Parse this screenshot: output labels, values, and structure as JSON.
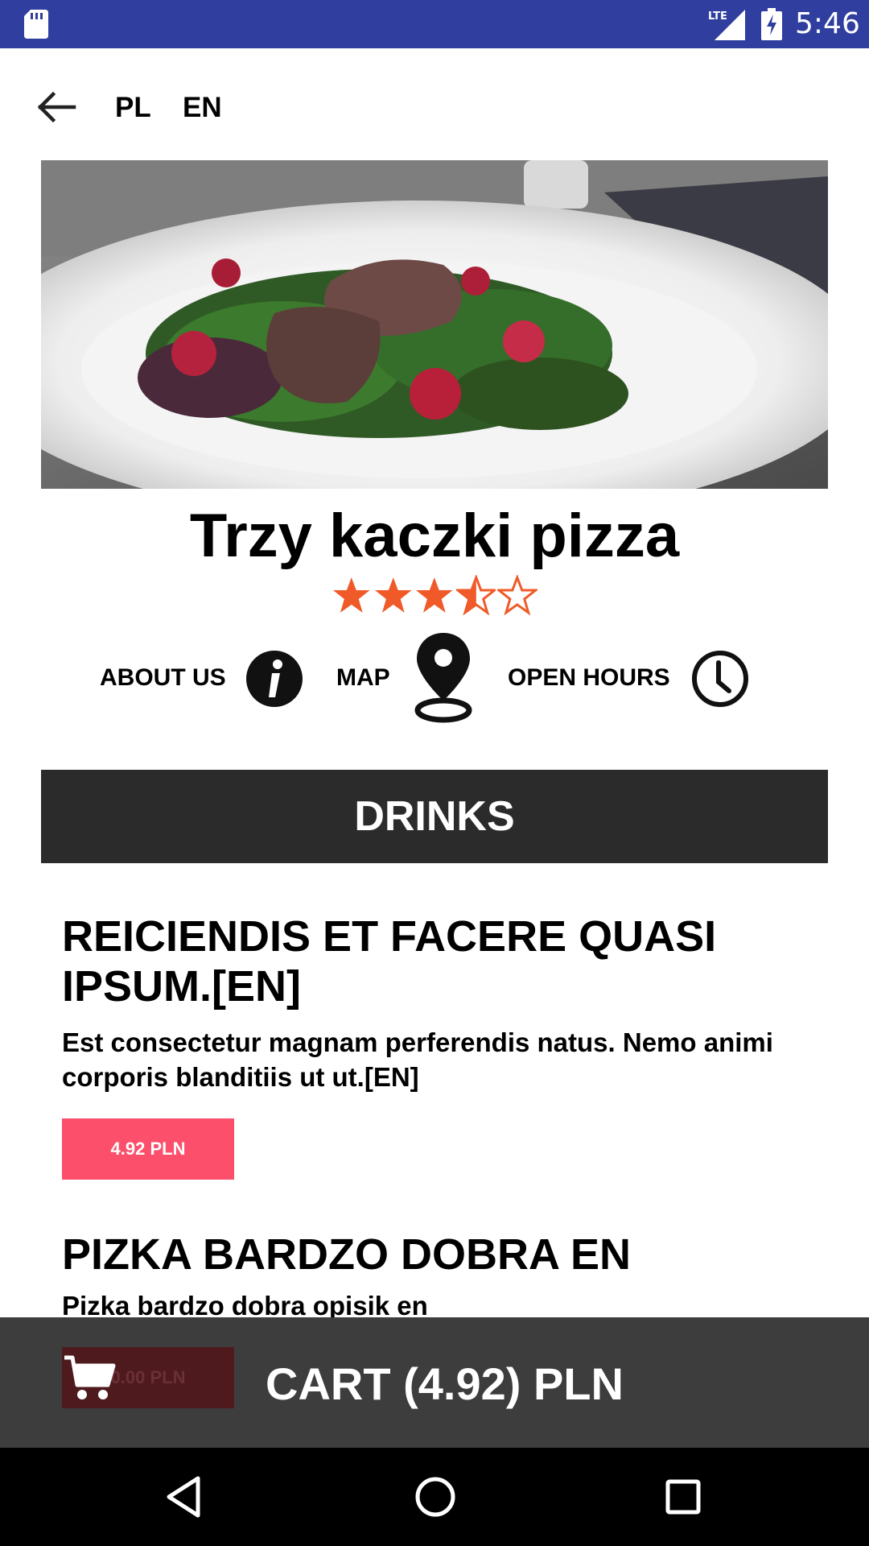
{
  "status_bar": {
    "time": "5:46",
    "network": "LTE",
    "color": "#303f9f",
    "icons": [
      "sd-card-icon",
      "lte-signal-icon",
      "battery-charging-icon"
    ]
  },
  "header": {
    "back_icon": "arrow-left-icon",
    "languages": [
      "PL",
      "EN"
    ]
  },
  "restaurant": {
    "name": "Trzy kaczki pizza",
    "rating": 3.5,
    "rating_max": 5,
    "star_color": "#f05a28"
  },
  "info": {
    "about_label": "ABOUT US",
    "about_icon": "info-icon",
    "map_label": "MAP",
    "map_icon": "map-pin-icon",
    "hours_label": "OPEN HOURS",
    "hours_icon": "clock-icon"
  },
  "menu": {
    "category": "DRINKS",
    "items": [
      {
        "title": "REICIENDIS ET FACERE QUASI IPSUM.[EN]",
        "description": "Est consectetur magnam perferendis natus. Nemo animi corporis blanditiis ut ut.[EN]",
        "price": "4.92 PLN"
      },
      {
        "title": "PIZKA BARDZO DOBRA EN",
        "description": "Pizka bardzo dobra opisik en",
        "price": "0.00 PLN"
      }
    ]
  },
  "cart": {
    "icon": "shopping-cart-icon",
    "label": "CART (4.92) PLN"
  },
  "nav_bar": {
    "icons": [
      "nav-back-icon",
      "nav-home-icon",
      "nav-recents-icon"
    ]
  },
  "colors": {
    "price_button": "#fb4f6b",
    "banner": "#2b2b2b",
    "cart_bar": "#3d3d3d"
  }
}
